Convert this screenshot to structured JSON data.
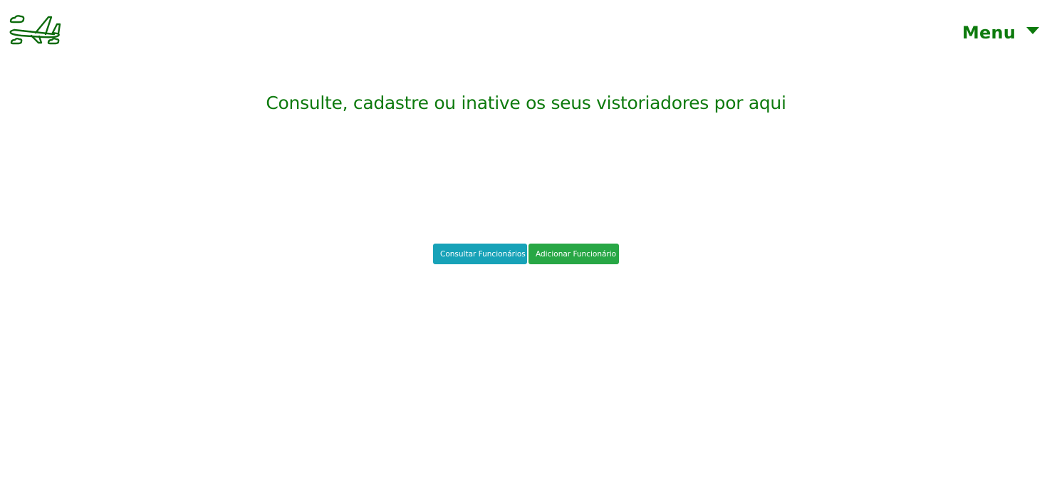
{
  "header": {
    "logo_icon": "airplane-icon",
    "menu_label": "Menu",
    "menu_icon": "caret-down-icon"
  },
  "main": {
    "headline": "Consulte, cadastre ou inative os seus vistoriadores por aqui",
    "buttons": {
      "consult_label": "Consultar Funcionários",
      "add_label": "Adicionar Funcionário"
    }
  },
  "colors": {
    "brand_green": "#0d7a0d",
    "info": "#17a2b8",
    "success": "#28a745"
  }
}
